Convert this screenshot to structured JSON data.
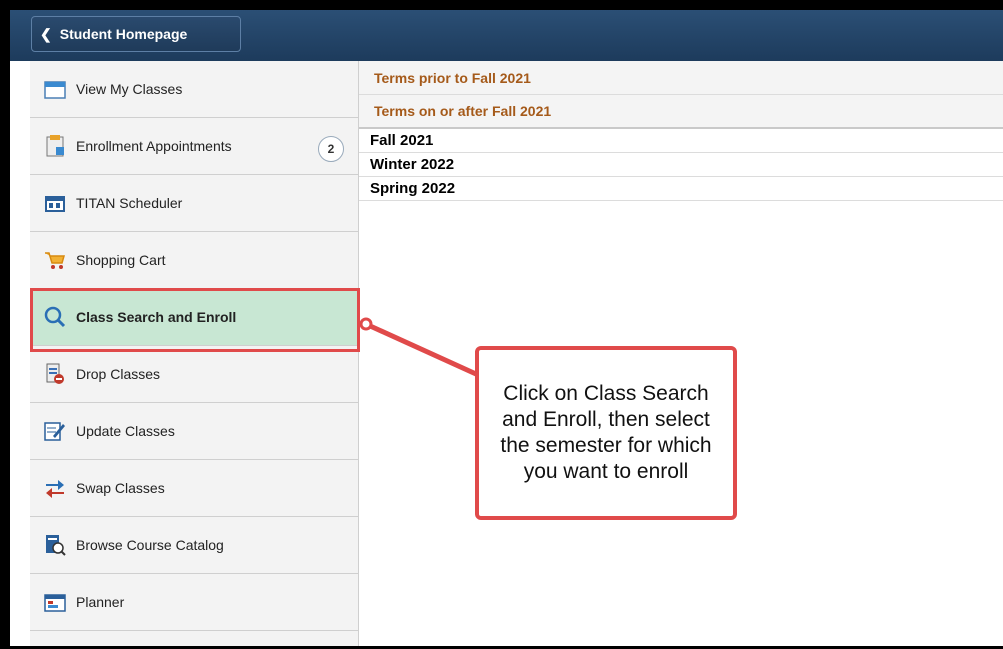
{
  "header": {
    "back_button_label": "Student Homepage"
  },
  "sidebar": {
    "items": [
      {
        "label": "View My Classes",
        "icon": "calendar-icon"
      },
      {
        "label": "Enrollment Appointments",
        "icon": "appointment-icon",
        "badge": "2"
      },
      {
        "label": "TITAN Scheduler",
        "icon": "scheduler-icon"
      },
      {
        "label": "Shopping Cart",
        "icon": "cart-icon"
      },
      {
        "label": "Class Search and Enroll",
        "icon": "search-icon",
        "active": true
      },
      {
        "label": "Drop Classes",
        "icon": "drop-icon"
      },
      {
        "label": "Update Classes",
        "icon": "edit-icon"
      },
      {
        "label": "Swap Classes",
        "icon": "swap-icon"
      },
      {
        "label": "Browse Course Catalog",
        "icon": "catalog-icon"
      },
      {
        "label": "Planner",
        "icon": "planner-icon"
      }
    ]
  },
  "terms": {
    "prior_header": "Terms prior to Fall 2021",
    "after_header": "Terms on or after Fall 2021",
    "list": [
      "Fall 2021",
      "Winter 2022",
      "Spring 2022"
    ]
  },
  "callout": {
    "text": "Click on Class Search and Enroll, then select the semester for which you want to enroll"
  },
  "colors": {
    "header_bg": "#1d3b5c",
    "term_header_text": "#a55a1a",
    "active_bg": "#c8e7d3",
    "highlight": "#e04a4a"
  }
}
